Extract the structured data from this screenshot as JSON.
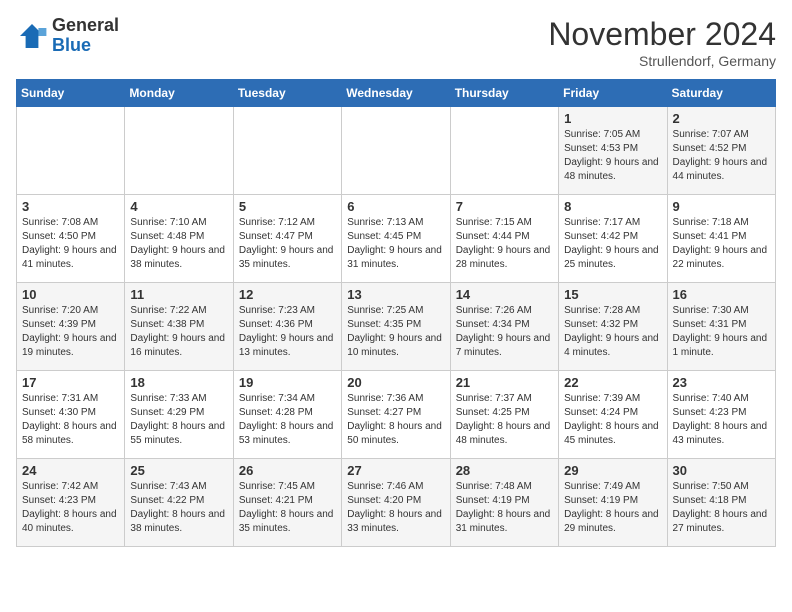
{
  "header": {
    "logo_general": "General",
    "logo_blue": "Blue",
    "month_title": "November 2024",
    "location": "Strullendorf, Germany"
  },
  "columns": [
    "Sunday",
    "Monday",
    "Tuesday",
    "Wednesday",
    "Thursday",
    "Friday",
    "Saturday"
  ],
  "weeks": [
    [
      {
        "day": "",
        "info": ""
      },
      {
        "day": "",
        "info": ""
      },
      {
        "day": "",
        "info": ""
      },
      {
        "day": "",
        "info": ""
      },
      {
        "day": "",
        "info": ""
      },
      {
        "day": "1",
        "info": "Sunrise: 7:05 AM\nSunset: 4:53 PM\nDaylight: 9 hours and 48 minutes."
      },
      {
        "day": "2",
        "info": "Sunrise: 7:07 AM\nSunset: 4:52 PM\nDaylight: 9 hours and 44 minutes."
      }
    ],
    [
      {
        "day": "3",
        "info": "Sunrise: 7:08 AM\nSunset: 4:50 PM\nDaylight: 9 hours and 41 minutes."
      },
      {
        "day": "4",
        "info": "Sunrise: 7:10 AM\nSunset: 4:48 PM\nDaylight: 9 hours and 38 minutes."
      },
      {
        "day": "5",
        "info": "Sunrise: 7:12 AM\nSunset: 4:47 PM\nDaylight: 9 hours and 35 minutes."
      },
      {
        "day": "6",
        "info": "Sunrise: 7:13 AM\nSunset: 4:45 PM\nDaylight: 9 hours and 31 minutes."
      },
      {
        "day": "7",
        "info": "Sunrise: 7:15 AM\nSunset: 4:44 PM\nDaylight: 9 hours and 28 minutes."
      },
      {
        "day": "8",
        "info": "Sunrise: 7:17 AM\nSunset: 4:42 PM\nDaylight: 9 hours and 25 minutes."
      },
      {
        "day": "9",
        "info": "Sunrise: 7:18 AM\nSunset: 4:41 PM\nDaylight: 9 hours and 22 minutes."
      }
    ],
    [
      {
        "day": "10",
        "info": "Sunrise: 7:20 AM\nSunset: 4:39 PM\nDaylight: 9 hours and 19 minutes."
      },
      {
        "day": "11",
        "info": "Sunrise: 7:22 AM\nSunset: 4:38 PM\nDaylight: 9 hours and 16 minutes."
      },
      {
        "day": "12",
        "info": "Sunrise: 7:23 AM\nSunset: 4:36 PM\nDaylight: 9 hours and 13 minutes."
      },
      {
        "day": "13",
        "info": "Sunrise: 7:25 AM\nSunset: 4:35 PM\nDaylight: 9 hours and 10 minutes."
      },
      {
        "day": "14",
        "info": "Sunrise: 7:26 AM\nSunset: 4:34 PM\nDaylight: 9 hours and 7 minutes."
      },
      {
        "day": "15",
        "info": "Sunrise: 7:28 AM\nSunset: 4:32 PM\nDaylight: 9 hours and 4 minutes."
      },
      {
        "day": "16",
        "info": "Sunrise: 7:30 AM\nSunset: 4:31 PM\nDaylight: 9 hours and 1 minute."
      }
    ],
    [
      {
        "day": "17",
        "info": "Sunrise: 7:31 AM\nSunset: 4:30 PM\nDaylight: 8 hours and 58 minutes."
      },
      {
        "day": "18",
        "info": "Sunrise: 7:33 AM\nSunset: 4:29 PM\nDaylight: 8 hours and 55 minutes."
      },
      {
        "day": "19",
        "info": "Sunrise: 7:34 AM\nSunset: 4:28 PM\nDaylight: 8 hours and 53 minutes."
      },
      {
        "day": "20",
        "info": "Sunrise: 7:36 AM\nSunset: 4:27 PM\nDaylight: 8 hours and 50 minutes."
      },
      {
        "day": "21",
        "info": "Sunrise: 7:37 AM\nSunset: 4:25 PM\nDaylight: 8 hours and 48 minutes."
      },
      {
        "day": "22",
        "info": "Sunrise: 7:39 AM\nSunset: 4:24 PM\nDaylight: 8 hours and 45 minutes."
      },
      {
        "day": "23",
        "info": "Sunrise: 7:40 AM\nSunset: 4:23 PM\nDaylight: 8 hours and 43 minutes."
      }
    ],
    [
      {
        "day": "24",
        "info": "Sunrise: 7:42 AM\nSunset: 4:23 PM\nDaylight: 8 hours and 40 minutes."
      },
      {
        "day": "25",
        "info": "Sunrise: 7:43 AM\nSunset: 4:22 PM\nDaylight: 8 hours and 38 minutes."
      },
      {
        "day": "26",
        "info": "Sunrise: 7:45 AM\nSunset: 4:21 PM\nDaylight: 8 hours and 35 minutes."
      },
      {
        "day": "27",
        "info": "Sunrise: 7:46 AM\nSunset: 4:20 PM\nDaylight: 8 hours and 33 minutes."
      },
      {
        "day": "28",
        "info": "Sunrise: 7:48 AM\nSunset: 4:19 PM\nDaylight: 8 hours and 31 minutes."
      },
      {
        "day": "29",
        "info": "Sunrise: 7:49 AM\nSunset: 4:19 PM\nDaylight: 8 hours and 29 minutes."
      },
      {
        "day": "30",
        "info": "Sunrise: 7:50 AM\nSunset: 4:18 PM\nDaylight: 8 hours and 27 minutes."
      }
    ]
  ]
}
